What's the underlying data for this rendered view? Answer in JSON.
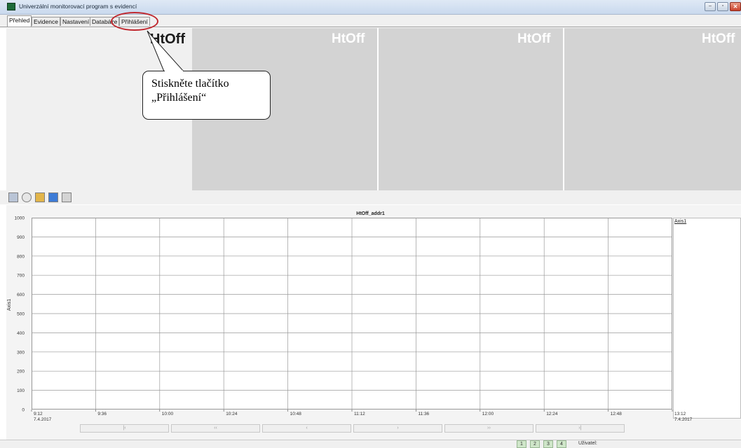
{
  "window": {
    "title": "Univerzální monitorovací program s evidencí",
    "controls": {
      "minimize": "–",
      "maximize": "▫",
      "close": "✕"
    }
  },
  "tabs": [
    {
      "label": "Přehled",
      "active": true
    },
    {
      "label": "Evidence",
      "active": false
    },
    {
      "label": "Nastavení",
      "active": false
    },
    {
      "label": "Databáze",
      "active": false
    },
    {
      "label": "Přihlášení",
      "active": false
    }
  ],
  "panels": [
    {
      "title": "HtOff"
    },
    {
      "title": "HtOff"
    },
    {
      "title": "HtOff"
    },
    {
      "title": "HtOff"
    }
  ],
  "callout": {
    "line1": "Stiskněte tlačítko",
    "line2": "„Přihlášení“"
  },
  "toolbar": {
    "icons": [
      "edit-icon",
      "refresh-icon",
      "folders-icon",
      "save-icon",
      "print-icon"
    ]
  },
  "chart_data": {
    "type": "line",
    "title": "HtOff_addr1",
    "ylabel": "Axis1",
    "legend": [
      "Axis1"
    ],
    "legend_position": "right",
    "ylim": [
      0,
      1000
    ],
    "yticks": [
      0,
      100,
      200,
      300,
      400,
      500,
      600,
      700,
      800,
      900,
      1000
    ],
    "xticks": [
      "9:12",
      "9:36",
      "10:00",
      "10:24",
      "10:48",
      "11:12",
      "11:36",
      "12:00",
      "12:24",
      "12:48",
      "13:12"
    ],
    "date_labels": {
      "start": "7.4.2017",
      "end": "7.4.2017"
    },
    "grid": true,
    "series": []
  },
  "scroll_buttons": [
    "|‹",
    "‹‹",
    "‹",
    "›",
    "››",
    "›|"
  ],
  "status": {
    "pages": [
      "1",
      "2",
      "3",
      "4"
    ],
    "user_label": "Uživatel:"
  }
}
